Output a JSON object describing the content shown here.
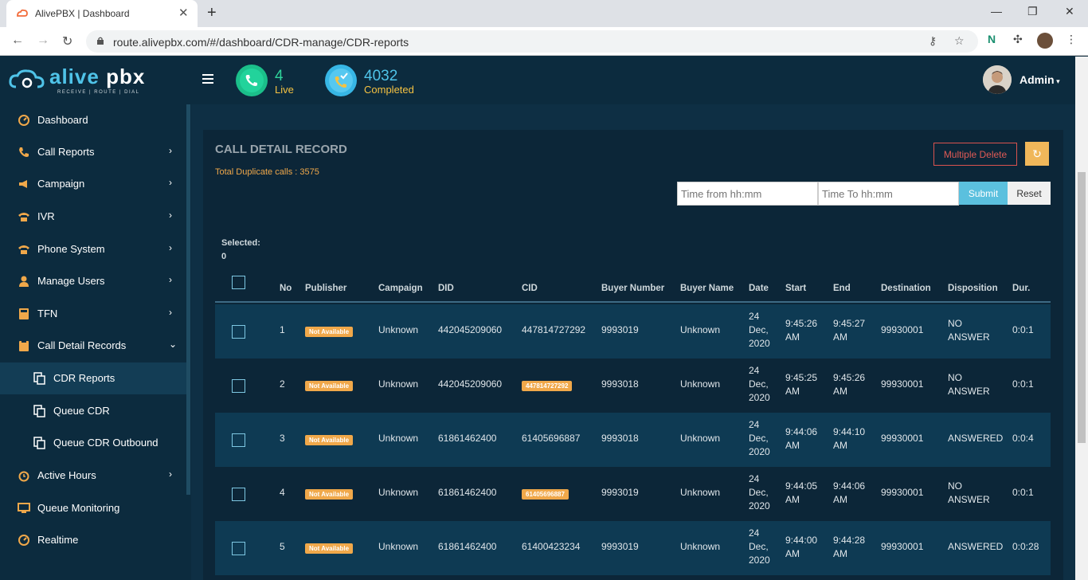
{
  "browser": {
    "tab_title": "AlivePBX | Dashboard",
    "url": "route.alivepbx.com/#/dashboard/CDR-manage/CDR-reports",
    "new_tab": "+",
    "tab_close": "✕"
  },
  "header": {
    "logo_main": "alive",
    "logo_pbx": "pbx",
    "logo_tagline": "RECEIVE | ROUTE | DIAL",
    "live_count": "4",
    "live_label": "Live",
    "completed_count": "4032",
    "completed_label": "Completed",
    "user": "Admin"
  },
  "sidebar": {
    "items": [
      {
        "label": "Dashboard",
        "icon": "dashboard-icon"
      },
      {
        "label": "Call Reports",
        "icon": "phone-icon"
      },
      {
        "label": "Campaign",
        "icon": "megaphone-icon"
      },
      {
        "label": "IVR",
        "icon": "ivr-icon"
      },
      {
        "label": "Phone System",
        "icon": "phone-system-icon"
      },
      {
        "label": "Manage Users",
        "icon": "user-icon"
      },
      {
        "label": "TFN",
        "icon": "calculator-icon"
      },
      {
        "label": "Call Detail Records",
        "icon": "clipboard-icon"
      },
      {
        "label": "CDR Reports",
        "icon": "copy-icon"
      },
      {
        "label": "Queue CDR",
        "icon": "copy-icon"
      },
      {
        "label": "Queue CDR Outbound",
        "icon": "copy-icon"
      },
      {
        "label": "Active Hours",
        "icon": "alarm-icon"
      },
      {
        "label": "Queue Monitoring",
        "icon": "monitor-icon"
      },
      {
        "label": "Realtime",
        "icon": "dashboard-icon"
      }
    ]
  },
  "cdr": {
    "title": "CALL DETAIL RECORD",
    "duplicate_calls": "Total Duplicate calls : 3575",
    "multiple_delete": "Multiple Delete",
    "refresh_icon": "refresh-icon",
    "time_from_placeholder": "Time from hh:mm",
    "time_to_placeholder": "Time To hh:mm",
    "submit": "Submit",
    "reset": "Reset",
    "selected_label": "Selected:",
    "selected_count": "0"
  },
  "table": {
    "headers": [
      "No",
      "Publisher",
      "Campaign",
      "DID",
      "CID",
      "Buyer Number",
      "Buyer Name",
      "Date",
      "Start",
      "End",
      "Destination",
      "Disposition",
      "Dur."
    ],
    "rows": [
      {
        "no": "1",
        "publisher": "Not Available",
        "campaign": "Unknown",
        "did": "442045209060",
        "cid": "447814727292",
        "cid_badge": false,
        "buyer_number": "9993019",
        "buyer_name": "Unknown",
        "date_day": "24",
        "date_mon": "Dec,",
        "date_year": "2020",
        "start_time": "9:45:26",
        "start_ampm": "AM",
        "end_time": "9:45:27",
        "end_ampm": "AM",
        "destination": "99930001",
        "disp_1": "NO",
        "disp_2": "ANSWER",
        "dur": "0:0:1"
      },
      {
        "no": "2",
        "publisher": "Not Available",
        "campaign": "Unknown",
        "did": "442045209060",
        "cid": "447814727292",
        "cid_badge": true,
        "buyer_number": "9993018",
        "buyer_name": "Unknown",
        "date_day": "24",
        "date_mon": "Dec,",
        "date_year": "2020",
        "start_time": "9:45:25",
        "start_ampm": "AM",
        "end_time": "9:45:26",
        "end_ampm": "AM",
        "destination": "99930001",
        "disp_1": "NO",
        "disp_2": "ANSWER",
        "dur": "0:0:1"
      },
      {
        "no": "3",
        "publisher": "Not Available",
        "campaign": "Unknown",
        "did": "61861462400",
        "cid": "61405696887",
        "cid_badge": false,
        "buyer_number": "9993018",
        "buyer_name": "Unknown",
        "date_day": "24",
        "date_mon": "Dec,",
        "date_year": "2020",
        "start_time": "9:44:06",
        "start_ampm": "AM",
        "end_time": "9:44:10",
        "end_ampm": "AM",
        "destination": "99930001",
        "disp_1": "ANSWERED",
        "disp_2": "",
        "dur": "0:0:4"
      },
      {
        "no": "4",
        "publisher": "Not Available",
        "campaign": "Unknown",
        "did": "61861462400",
        "cid": "61405696887",
        "cid_badge": true,
        "buyer_number": "9993019",
        "buyer_name": "Unknown",
        "date_day": "24",
        "date_mon": "Dec,",
        "date_year": "2020",
        "start_time": "9:44:05",
        "start_ampm": "AM",
        "end_time": "9:44:06",
        "end_ampm": "AM",
        "destination": "99930001",
        "disp_1": "NO",
        "disp_2": "ANSWER",
        "dur": "0:0:1"
      },
      {
        "no": "5",
        "publisher": "Not Available",
        "campaign": "Unknown",
        "did": "61861462400",
        "cid": "61400423234",
        "cid_badge": false,
        "buyer_number": "9993019",
        "buyer_name": "Unknown",
        "date_day": "24",
        "date_mon": "Dec,",
        "date_year": "2020",
        "start_time": "9:44:00",
        "start_ampm": "AM",
        "end_time": "9:44:28",
        "end_ampm": "AM",
        "destination": "99930001",
        "disp_1": "ANSWERED",
        "disp_2": "",
        "dur": "0:0:28"
      }
    ]
  },
  "colors": {
    "accent_orange": "#f0a84a",
    "accent_blue": "#5bc0de",
    "danger": "#d9534f",
    "bg_dark": "#0c2b3e"
  }
}
